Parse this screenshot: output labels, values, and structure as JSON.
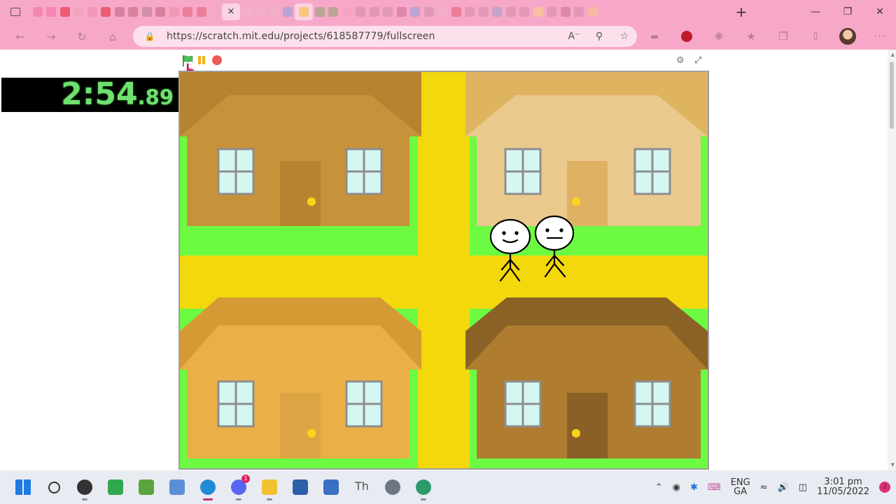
{
  "browser": {
    "url": "https://scratch.mit.edu/projects/618587779/fullscreen",
    "tab_favicon_colors": [
      "#f06b9a",
      "#f06b9a",
      "#e31c2a",
      "#f19fb8",
      "#f08bb0",
      "#e31c2a",
      "#c0607c",
      "#c0607c",
      "#b27a8d",
      "#c0607c",
      "#e58aa8",
      "#e35a6e",
      "#e35a6e",
      "#f4a9c0",
      "#f4b2c7",
      "#f4b2c7",
      "#f4b2c7",
      "#8d9ee0",
      "#f7c77b",
      "#8aa36a",
      "#8aa36a",
      "#f49cb9",
      "#d08aa5",
      "#d08aa5",
      "#d08aa5",
      "#c86b90",
      "#8d9ee0",
      "#d08aa5",
      "#f4b2c7",
      "#e35a6e",
      "#d08aa5",
      "#d08aa5",
      "#9aa0c8",
      "#d08aa5",
      "#d08aa5",
      "#f7d27b",
      "#d08aa5",
      "#c86b90",
      "#d08aa5",
      "#f7c77b"
    ],
    "close_tab_label": "×",
    "new_tab_label": "+"
  },
  "timer": {
    "main": "2:54",
    "fraction": ".89"
  },
  "taskbar": {
    "lang_top": "ENG",
    "lang_bottom": "GA",
    "time": "3:01 pm",
    "date": "11/05/2022",
    "notification_count": "2",
    "discord_badge": "1",
    "apps": [
      {
        "name": "start",
        "color": "#1e7be3"
      },
      {
        "name": "search",
        "color": "#333333"
      },
      {
        "name": "obs",
        "color": "#333333"
      },
      {
        "name": "drive",
        "color": "#2fa84f"
      },
      {
        "name": "minecraft",
        "color": "#5aa33d"
      },
      {
        "name": "photos",
        "color": "#5a8fd6"
      },
      {
        "name": "edge",
        "color": "#1f8ad6"
      },
      {
        "name": "discord",
        "color": "#5865f2"
      },
      {
        "name": "files",
        "color": "#f2c230"
      },
      {
        "name": "word",
        "color": "#2d5ea8"
      },
      {
        "name": "snip",
        "color": "#3b6fc4"
      },
      {
        "name": "typora",
        "color": "#555555"
      },
      {
        "name": "settings",
        "color": "#6d7682"
      },
      {
        "name": "edge-dev",
        "color": "#2a9c6b"
      }
    ]
  },
  "scene": {
    "colors": {
      "grass": "#6cfa42",
      "road": "#f2d80c",
      "house1": "#c8923a",
      "house2": "#eac98d",
      "house3": "#eaaf47",
      "house4": "#b07c30",
      "window": "#d5f7f2",
      "knob": "#ffd31a"
    }
  }
}
